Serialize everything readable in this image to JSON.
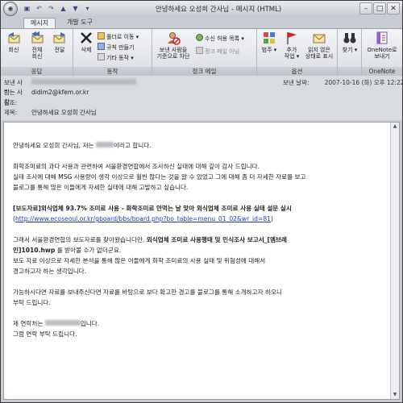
{
  "window": {
    "title": "안녕하세요 오성희 간사님 - 메시지 (HTML)"
  },
  "ribbon_tabs": [
    "메시지",
    "개발 도구"
  ],
  "ribbon": {
    "groups": {
      "respond": "응답",
      "actions": "동작",
      "junk": "정크 메일",
      "options": "옵션",
      "find": "",
      "onenote": "OneNote"
    },
    "buttons": {
      "reply": "회신",
      "reply_all_1": "전체",
      "reply_all_2": "회신",
      "forward": "전달",
      "delete": "삭제",
      "move_to_folder": "폴더로 이동",
      "create_rule": "규칙 만들기",
      "other_actions": "기타 동작",
      "block_sender_1": "보낸 사람을",
      "block_sender_2": "기준으로 차단",
      "safe_list": "수신 허용 목록",
      "not_junk": "정크 메일 아님",
      "categorize": "범주",
      "follow_up_1": "추가",
      "follow_up_2": "작업",
      "mark_unread_1": "읽지 않은",
      "mark_unread_2": "상태로 표시",
      "find": "찾기",
      "onenote_1": "OneNote로",
      "onenote_2": "보내기"
    }
  },
  "header": {
    "from_label": "보낸 사람:",
    "to_label": "받는 사람:",
    "to_value": "didim2@kfem.or.kr",
    "cc_label": "참조:",
    "subject_label": "제목:",
    "subject_value": "안녕하세요 오성희 간사님",
    "sent_label": "보낸 날짜:",
    "sent_value": "2007-10-16 (화) 오후 12:22"
  },
  "message": {
    "greeting_pre": "안녕하세요 오성희 간사님, 저는 ",
    "greeting_post": "이라고 합니다.",
    "p1_line1": "화학조미료의 과다 사용과 관련하여 서울환경연합에서 조사하신 실태에 대해 깊이 감사 드립니다.",
    "p1_line2": "실태 조사에 대해 MSG 사용량이 생각 이상으로 훨씬 많다는 것을 알 수 있었고 그에 대해 좀 더 자세한 자료를 보고",
    "p1_line3": "블로그를 통해 많은 이들에게 자세한 실태에 대해 고발하고 싶습니다.",
    "press_title": "[보도자료]외식업체 93.7% 조미료 사용 - 화학조미료 안먹는 날 맞아 외식업체 조미료 사용 실태 설문 실시",
    "press_link": "http://www.ecoseoul.or.kr/gboard/bbs/board.php?bo_table=menu_01_02&wr_id=81",
    "p2_line1_pre": "그래서  서울환경연합의  보도자료를  찾아왔습니다만,  ",
    "p2_line1_bold": "외식업체  조미료  사용행태  및  인식조사  보고서_[엠브레",
    "p2_line2_bold": "인]1010.hwp",
    "p2_line2_post": " 를 받아볼 수가 없더군요.",
    "p2_line3": "보도 자료 이상으로 자세한 분석을 통해 많은 이들에게 화학 조미료의 사용 실태 및 위험성에 대해서",
    "p2_line4": "경고하고자 하는 생각입니다.",
    "p3_line1": "가능하시다면 자료를 보내주신다면 자료를 바탕으로 보다 확고한 경고를 블로그를 통해 소개하고자 하오니",
    "p3_line2": "부탁 드립니다.",
    "contact_pre": "제 연락처는 ",
    "contact_post": "입니다.",
    "closing": "그럼 연락 부탁 드립니다."
  }
}
